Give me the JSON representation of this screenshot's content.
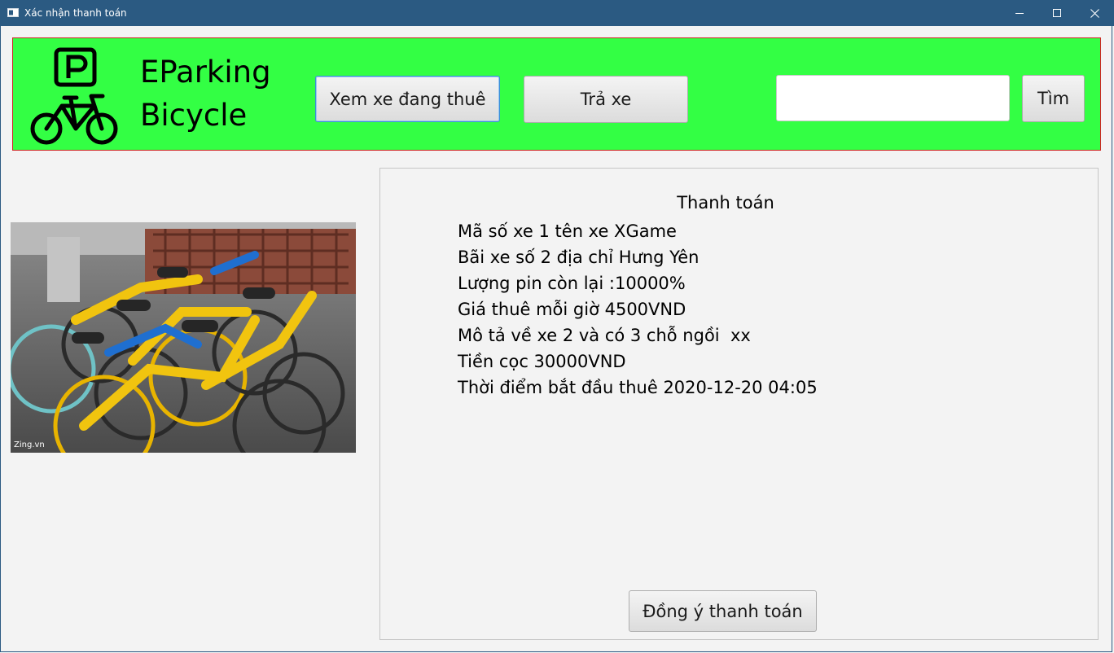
{
  "window": {
    "title": "Xác nhận thanh toán"
  },
  "brand": {
    "line1": "EParking",
    "line2": "Bicycle"
  },
  "toolbar": {
    "view_rented_label": "Xem xe đang thuê",
    "return_label": "Trả xe",
    "search_placeholder": "",
    "search_value": "",
    "search_label": "Tìm"
  },
  "image": {
    "watermark": "Zing.vn"
  },
  "payment": {
    "title": "Thanh toán",
    "lines": [
      "Mã số xe 1 tên xe XGame",
      "Bãi xe số 2 địa chỉ Hưng Yên",
      "Lượng pin còn lại :10000%",
      "Giá thuê mỗi giờ 4500VND",
      "Mô tả về xe 2 và có 3 chỗ ngồi  xx",
      "Tiền cọc 30000VND",
      "Thời điểm bắt đầu thuê 2020-12-20 04:05"
    ],
    "confirm_label": "Đồng ý thanh toán"
  },
  "colors": {
    "titlebar": "#2b5a82",
    "header_bg": "#33ff44",
    "header_border": "#d02222",
    "focus": "#3a8fd8"
  },
  "icons": [
    "app-icon",
    "minimize-icon",
    "maximize-icon",
    "close-icon",
    "parking-bicycle-logo-icon"
  ]
}
